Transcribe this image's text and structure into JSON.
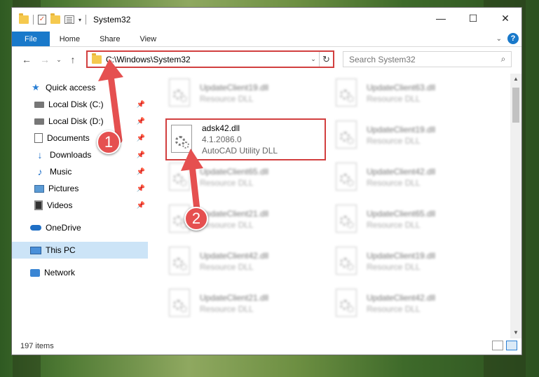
{
  "window": {
    "title": "System32",
    "controls": {
      "minimize": "—",
      "maximize": "☐",
      "close": "✕"
    }
  },
  "ribbon": {
    "tabs": [
      {
        "label": "File"
      },
      {
        "label": "Home"
      },
      {
        "label": "Share"
      },
      {
        "label": "View"
      }
    ],
    "help": "?"
  },
  "addressbar": {
    "path": "C:\\Windows\\System32",
    "search_placeholder": "Search System32"
  },
  "sidebar": {
    "quick_access": "Quick access",
    "items": [
      {
        "label": "Local Disk (C:)"
      },
      {
        "label": "Local Disk (D:)"
      },
      {
        "label": "Documents"
      },
      {
        "label": "Downloads"
      },
      {
        "label": "Music"
      },
      {
        "label": "Pictures"
      },
      {
        "label": "Videos"
      }
    ],
    "onedrive": "OneDrive",
    "thispc": "This PC",
    "network": "Network"
  },
  "files": {
    "left": [
      {
        "name": "UpdateClient19.dll",
        "type": "Resource DLL"
      },
      {
        "name": "adsk42.dll",
        "type": "AutoCAD Utility DLL",
        "version": "4.1.2086.0"
      },
      {
        "name": "UpdateClient65.dll",
        "type": "Resource DLL"
      },
      {
        "name": "UpdateClient21.dll",
        "type": "Resource DLL"
      },
      {
        "name": "UpdateClient42.dll",
        "type": "Resource DLL"
      },
      {
        "name": "UpdateClient21.dll",
        "type": "Resource DLL"
      }
    ],
    "right": [
      {
        "name": "UpdateClient63.dll",
        "type": "Resource DLL"
      },
      {
        "name": "UpdateClient19.dll",
        "type": "Resource DLL"
      },
      {
        "name": "UpdateClient42.dll",
        "type": "Resource DLL"
      },
      {
        "name": "UpdateClient65.dll",
        "type": "Resource DLL"
      },
      {
        "name": "UpdateClient19.dll",
        "type": "Resource DLL"
      },
      {
        "name": "UpdateClient42.dll",
        "type": "Resource DLL"
      }
    ]
  },
  "status": {
    "count": "197 items"
  },
  "annotations": {
    "step1": "1",
    "step2": "2",
    "color": "#e55050"
  }
}
